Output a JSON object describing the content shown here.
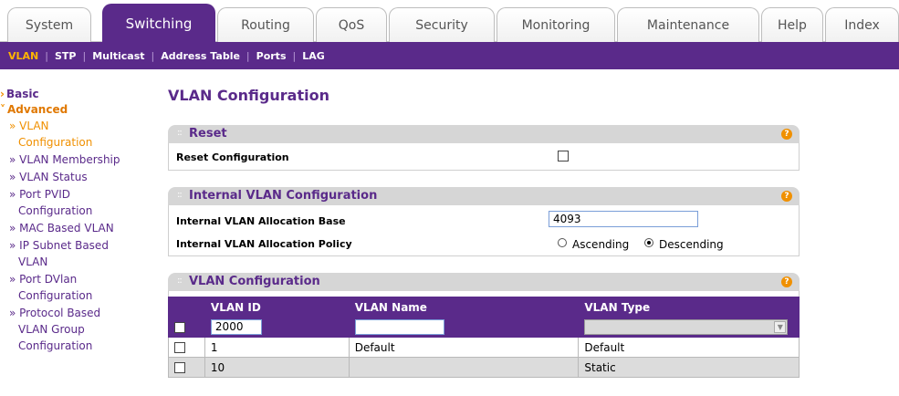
{
  "top_tabs": [
    {
      "label": "System"
    },
    {
      "label": "Switching"
    },
    {
      "label": "Routing"
    },
    {
      "label": "QoS"
    },
    {
      "label": "Security"
    },
    {
      "label": "Monitoring"
    },
    {
      "label": "Maintenance"
    },
    {
      "label": "Help"
    },
    {
      "label": "Index"
    }
  ],
  "active_top_tab": "Switching",
  "sub_nav": [
    {
      "label": "VLAN"
    },
    {
      "label": "STP"
    },
    {
      "label": "Multicast"
    },
    {
      "label": "Address Table"
    },
    {
      "label": "Ports"
    },
    {
      "label": "LAG"
    }
  ],
  "active_sub_nav": "VLAN",
  "left_nav": {
    "basic": "Basic",
    "advanced": "Advanced",
    "items": [
      {
        "line1": "» VLAN",
        "line2": "Configuration"
      },
      {
        "line1": "» VLAN Membership"
      },
      {
        "line1": "» VLAN Status"
      },
      {
        "line1": "» Port PVID",
        "line2": "Configuration"
      },
      {
        "line1": "» MAC Based VLAN"
      },
      {
        "line1": "» IP Subnet Based",
        "line2": "VLAN"
      },
      {
        "line1": "» Port DVlan",
        "line2": "Configuration"
      },
      {
        "line1": "» Protocol Based",
        "line2": "VLAN Group",
        "line3": "Configuration"
      }
    ]
  },
  "page_title": "VLAN Configuration",
  "reset_panel": {
    "title": "Reset",
    "row_label": "Reset Configuration",
    "checked": false
  },
  "internal_panel": {
    "title": "Internal VLAN Configuration",
    "base_label": "Internal VLAN Allocation Base",
    "base_value": "4093",
    "policy_label": "Internal VLAN Allocation Policy",
    "policy_options": [
      "Ascending",
      "Descending"
    ],
    "policy_selected": "Descending"
  },
  "vlan_table": {
    "title": "VLAN Configuration",
    "columns": [
      "",
      "VLAN ID",
      "VLAN Name",
      "VLAN Type"
    ],
    "new_row": {
      "vlan_id": "2000",
      "vlan_name": "",
      "vlan_type": ""
    },
    "rows": [
      {
        "vlan_id": "1",
        "vlan_name": "Default",
        "vlan_type": "Default"
      },
      {
        "vlan_id": "10",
        "vlan_name": "",
        "vlan_type": "Static"
      }
    ]
  },
  "colors": {
    "brand_purple": "#5a2a8a",
    "accent_orange": "#f09000",
    "panel_grey": "#d6d6d6"
  }
}
